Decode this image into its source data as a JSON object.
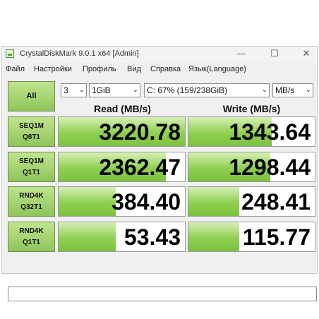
{
  "window": {
    "title": "CrystalDiskMark 9.0.1 x64 [Admin]",
    "controls": {
      "minimize": "—",
      "maximize": "☐",
      "close": "✕"
    }
  },
  "menu": [
    "Файл",
    "Настройки",
    "Профиль",
    "Вид",
    "Справка",
    "Язык(Language)"
  ],
  "toolbar": {
    "all_label": "All",
    "count": "3",
    "size": "1GiB",
    "drive": "C: 67% (159/238GiB)",
    "unit": "MB/s"
  },
  "headers": {
    "read": "Read (MB/s)",
    "write": "Write (MB/s)"
  },
  "rows": [
    {
      "line1": "SEQ1M",
      "line2": "Q8T1",
      "read": "3220.78",
      "write": "1343.64",
      "read_level": 1.0,
      "write_level": 0.66
    },
    {
      "line1": "SEQ1M",
      "line2": "Q1T1",
      "read": "2362.47",
      "write": "1298.44",
      "read_level": 0.85,
      "write_level": 0.65
    },
    {
      "line1": "RND4K",
      "line2": "Q32T1",
      "read": "384.40",
      "write": "248.41",
      "read_level": 0.45,
      "write_level": 0.4
    },
    {
      "line1": "RND4K",
      "line2": "Q1T1",
      "read": "53.43",
      "write": "115.77",
      "read_level": 0.45,
      "write_level": 0.4
    }
  ],
  "colors": {
    "accent_green": "#8fcf52",
    "label_green": "#9ed068"
  }
}
